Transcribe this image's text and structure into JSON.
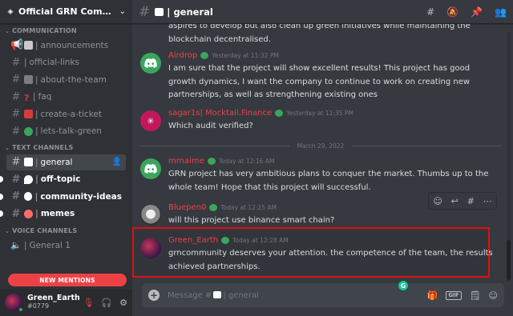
{
  "server": {
    "name": "Official GRN Commu…",
    "icon": "diamond-icon"
  },
  "categories": {
    "communication": "COMMUNICATION",
    "text": "TEXT CHANNELS",
    "voice": "VOICE CHANNELS"
  },
  "channels_communication": [
    {
      "name": "announcements",
      "emoji_color": "#e8e8e8"
    },
    {
      "name": "official-links",
      "emoji_color": ""
    },
    {
      "name": "about-the-team",
      "emoji_color": ""
    },
    {
      "name": "faq",
      "emoji_color": "#d83a3a"
    },
    {
      "name": "create-a-ticket",
      "emoji_color": "#d83a3a"
    },
    {
      "name": "lets-talk-green",
      "emoji_color": "#3ba55d"
    }
  ],
  "channels_text": [
    {
      "name": "general",
      "emoji_color": "#ffffff",
      "active": true
    },
    {
      "name": "off-topic",
      "emoji_color": "#ffffff",
      "unread": true
    },
    {
      "name": "community-ideas",
      "emoji_color": "#ffffff",
      "unread": true
    },
    {
      "name": "memes",
      "emoji_color": "#ff6b6b",
      "unread": true
    }
  ],
  "channels_voice": [
    {
      "name": "General 1"
    }
  ],
  "new_mentions": "NEW MENTIONS",
  "user": {
    "name": "Green_Earth",
    "tag": "#0779"
  },
  "header": {
    "channel": "| general"
  },
  "messages": [
    {
      "author": "",
      "timestamp": "",
      "text": "aspires to develop but also clean up green initiatives while maintaining the blockchain decentralised."
    },
    {
      "author": "Airdrop",
      "author_color": "#ed4245",
      "timestamp": "Yesterday at 11:32 PM",
      "text": "I am sure that the project will show excellent results! This project has good growth dynamics, I want the company to continue to work on creating new partnerships, as well as strengthening existing ones"
    },
    {
      "author": "sagar1s| Mocktail.Finance",
      "author_color": "#ed4245",
      "timestamp": "Yesterday at 11:35 PM",
      "text": "Which audit verified?"
    },
    {
      "author": "mrnaime",
      "author_color": "#ed4245",
      "timestamp": "Today at 12:16 AM",
      "text": "GRN project has very ambitious plans to conquer the market. Thumbs up to the whole team! Hope that this project will successful."
    },
    {
      "author": "Bluepen0",
      "author_color": "#ed4245",
      "timestamp": "Today at 12:25 AM",
      "text": "will this project use binance smart chain?"
    },
    {
      "author": "Green_Earth",
      "author_color": "#ed4245",
      "timestamp": "Today at 12:28 AM",
      "text": "grncommunity  deserves your attention. the competence of the team, the results achieved partnerships."
    }
  ],
  "date_divider": "March 29, 2022",
  "composer": {
    "placeholder_prefix": "Message #",
    "placeholder_channel": "| general",
    "grammarly": "G",
    "gif": "GIF"
  },
  "colors": {
    "accent_green": "#3ba55d",
    "mention_red": "#ed4245",
    "highlight_border": "#e01010"
  }
}
